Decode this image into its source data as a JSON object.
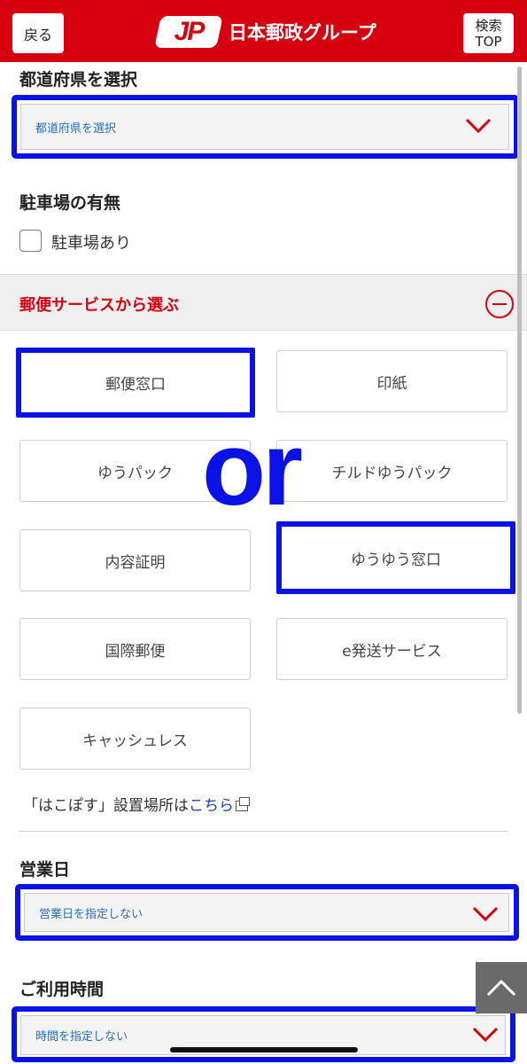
{
  "header": {
    "back_label": "戻る",
    "logo_mark": "JP",
    "logo_text": "日本郵政グループ",
    "search_top_line1": "検索",
    "search_top_line2": "TOP",
    "brand_color": "#d7000f"
  },
  "prefecture": {
    "label": "都道府県を選択",
    "value": "都道府県を選択"
  },
  "parking": {
    "label": "駐車場の有無",
    "checkbox_label": "駐車場あり",
    "checked": false
  },
  "postal_services": {
    "title": "郵便サービスから選ぶ",
    "items": [
      {
        "label": "郵便窓口",
        "highlighted": true
      },
      {
        "label": "印紙",
        "highlighted": false
      },
      {
        "label": "ゆうパック",
        "highlighted": false
      },
      {
        "label": "チルドゆうパック",
        "highlighted": false
      },
      {
        "label": "内容証明",
        "highlighted": false
      },
      {
        "label": "ゆうゆう窓口",
        "highlighted": true
      },
      {
        "label": "国際郵便",
        "highlighted": false
      },
      {
        "label": "e発送サービス",
        "highlighted": false
      },
      {
        "label": "キャッシュレス",
        "highlighted": false
      }
    ],
    "overlay_text": "or",
    "hakopos_prefix": "「はこぽす」設置場所は",
    "hakopos_link": "こちら"
  },
  "business_day": {
    "label": "営業日",
    "value": "営業日を指定しない"
  },
  "usage_time": {
    "label": "ご利用時間",
    "value": "時間を指定しない"
  },
  "colors": {
    "highlight": "#0a12e6",
    "accent_red": "#d7000f",
    "select_text": "#2b6fb3"
  },
  "icons": [
    "chevron-down-icon",
    "minus-circle-icon",
    "external-link-icon",
    "chevron-up-icon"
  ]
}
